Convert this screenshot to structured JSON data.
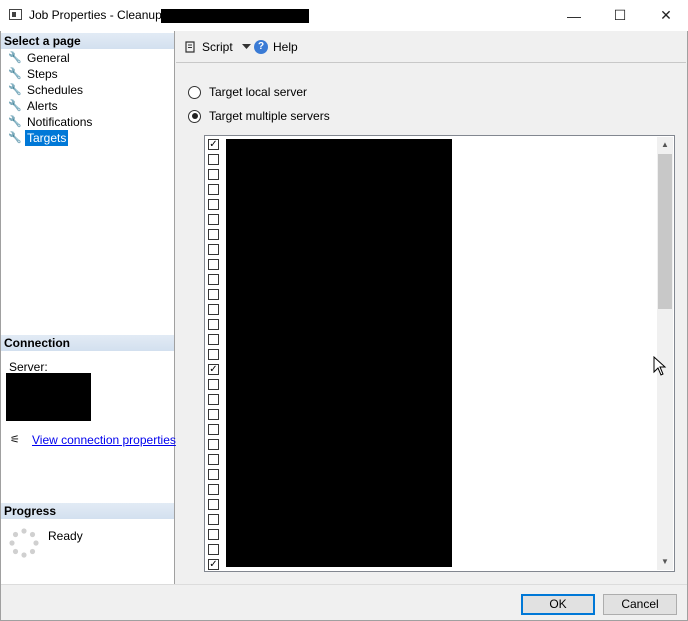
{
  "window": {
    "title": "Job Properties - Cleanup",
    "minimize_glyph": "—",
    "maximize_glyph": "☐",
    "close_glyph": "✕"
  },
  "left": {
    "select_page_header": "Select a page",
    "pages": [
      {
        "label": "General",
        "icon": "wrench-icon",
        "selected": false
      },
      {
        "label": "Steps",
        "icon": "wrench-icon",
        "selected": false
      },
      {
        "label": "Schedules",
        "icon": "wrench-icon",
        "selected": false
      },
      {
        "label": "Alerts",
        "icon": "wrench-icon",
        "selected": false
      },
      {
        "label": "Notifications",
        "icon": "wrench-icon",
        "selected": false
      },
      {
        "label": "Targets",
        "icon": "wrench-icon",
        "selected": true
      }
    ],
    "connection_header": "Connection",
    "server_label": "Server:",
    "view_connection_link": "View connection properties",
    "progress_header": "Progress",
    "progress_status": "Ready"
  },
  "toolbar": {
    "script_label": "Script",
    "help_label": "Help"
  },
  "targets": {
    "options": [
      {
        "label": "Target local server",
        "checked": false
      },
      {
        "label": "Target multiple servers",
        "checked": true
      }
    ],
    "server_rows_checked": [
      true,
      false,
      false,
      false,
      false,
      false,
      false,
      false,
      false,
      false,
      false,
      false,
      false,
      false,
      false,
      true,
      false,
      false,
      false,
      false,
      false,
      false,
      false,
      false,
      false,
      false,
      false,
      false,
      true
    ]
  },
  "buttons": {
    "ok": "OK",
    "cancel": "Cancel"
  },
  "colors": {
    "selection": "#0078d7",
    "link": "#0000ee",
    "header_gradient": "#d3e0ef"
  }
}
